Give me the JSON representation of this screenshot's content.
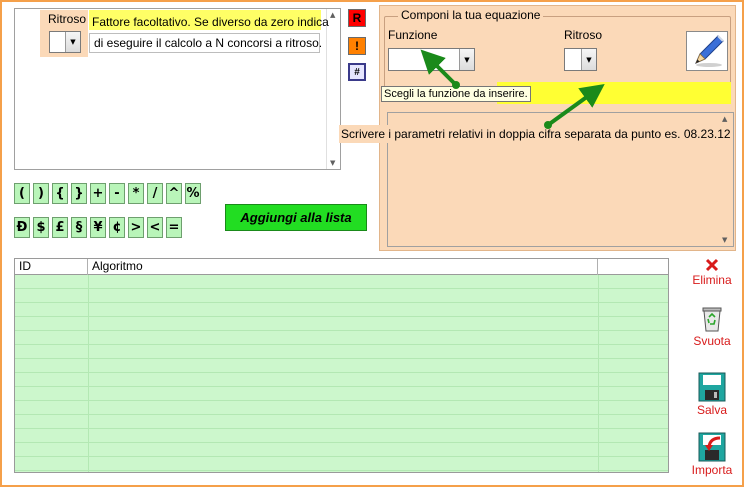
{
  "editor": {
    "ritroso_label": "Ritroso",
    "hint_line1": "Fattore facoltativo. Se diverso da zero indica",
    "hint_line2": "di eseguire il calcolo a N concorsi a ritroso.",
    "ritroso_value": ""
  },
  "side_buttons": {
    "r_label": "R",
    "exclaim_label": "!",
    "hash_label": "#",
    "r_color": "#ff0000",
    "exclaim_color": "#ff8000",
    "hash_color": "#e6e6ff"
  },
  "compose": {
    "group_title": "Componi la tua equazione",
    "funzione_label": "Funzione",
    "ritroso_label": "Ritroso",
    "funzione_value": "",
    "ritroso_value": "",
    "tooltip_funzione": "Scegli la funzione da inserire.",
    "tooltip_params": "Scrivere i parametri relativi in doppia cifra separata da punto es. 08.23.12",
    "param_value": "",
    "edit_icon": "pencil-icon",
    "highlight_color": "#ffff33",
    "arrow_color": "#1a8a1a"
  },
  "operators": {
    "row1": [
      "(",
      ")",
      "{",
      "}",
      "+",
      "-",
      "*",
      "/",
      "^",
      "%"
    ],
    "row2": [
      "Đ",
      "$",
      "£",
      "§",
      "¥",
      "¢",
      ">",
      "<",
      "="
    ]
  },
  "add_button": "Aggiungi alla lista",
  "grid": {
    "columns": [
      "ID",
      "Algoritmo",
      ""
    ],
    "rows": []
  },
  "actions": {
    "elimina": "Elimina",
    "svuota": "Svuota",
    "salva": "Salva",
    "importa": "Importa"
  }
}
